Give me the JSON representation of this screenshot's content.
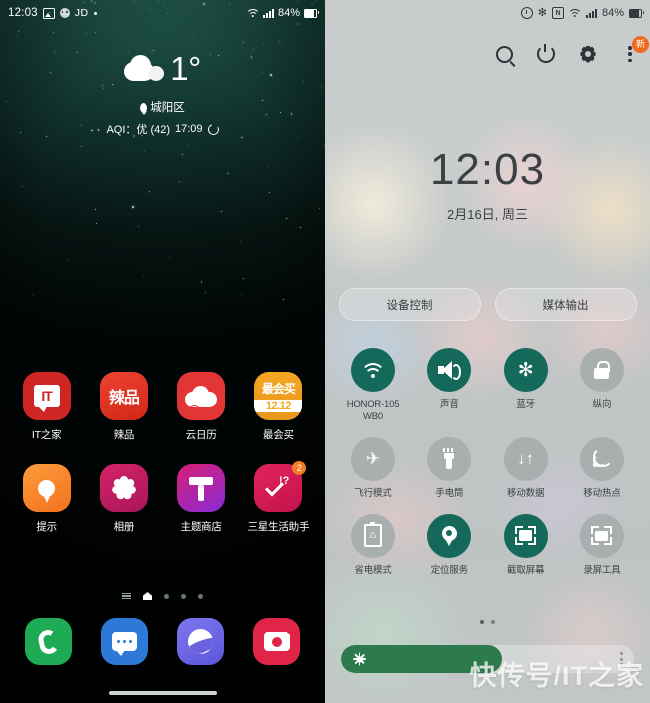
{
  "home": {
    "statusbar": {
      "time": "12:03",
      "icons": [
        "gallery-icon",
        "face-icon"
      ],
      "app_tag": "JD",
      "dot": "•",
      "wifi": "wifi-icon",
      "signal": "signal-bars-icon",
      "battery_pct": "84%",
      "battery": "battery-icon"
    },
    "weather": {
      "condition_icon": "cloud-icon",
      "temperature": "1°",
      "location": "城阳区",
      "location_icon": "location-pin-icon",
      "aqi": "AQI：优 (42)",
      "updated": "17:09",
      "refresh_icon": "refresh-icon"
    },
    "apps": [
      [
        {
          "label": "IT之家",
          "icon": "it-home-icon",
          "glyph": "IT"
        },
        {
          "label": "辣品",
          "icon": "lapin-icon",
          "glyph": "辣品"
        },
        {
          "label": "云日历",
          "icon": "cloud-calendar-icon",
          "glyph": ""
        },
        {
          "label": "最会买",
          "icon": "zuihuimai-icon",
          "glyph": "最会买",
          "sub": "12.12"
        }
      ],
      [
        {
          "label": "提示",
          "icon": "tips-icon",
          "glyph": ""
        },
        {
          "label": "相册",
          "icon": "gallery-app-icon",
          "glyph": ""
        },
        {
          "label": "主题商店",
          "icon": "theme-store-icon",
          "glyph": ""
        },
        {
          "label": "三星生活助手",
          "icon": "samsung-life-assistant-icon",
          "glyph": "",
          "badge": "2"
        }
      ]
    ],
    "page_indicator": {
      "pages": 4,
      "active": 0,
      "list_icon": "app-list-icon",
      "home_icon": "home-page-icon"
    },
    "dock": [
      {
        "label": "phone",
        "icon": "phone-icon"
      },
      {
        "label": "messages",
        "icon": "messages-icon"
      },
      {
        "label": "internet",
        "icon": "internet-browser-icon"
      },
      {
        "label": "camera",
        "icon": "camera-icon"
      }
    ],
    "nav_handle": "navigation-handle"
  },
  "panel": {
    "statusbar": {
      "alarm": "alarm-icon",
      "bluetooth": "bluetooth-icon",
      "bt_glyph": "✻",
      "nfc": "nfc-icon",
      "nfc_glyph": "N",
      "wifi": "wifi-icon",
      "signal": "signal-bars-icon",
      "battery_pct": "84%",
      "battery": "battery-icon"
    },
    "header": {
      "search": "search-icon",
      "power": "power-icon",
      "settings": "gear-icon",
      "more": "more-options-icon",
      "more_badge": "新"
    },
    "clock": {
      "time": "12:03",
      "date": "2月16日, 周三"
    },
    "pills": [
      {
        "label": "设备控制"
      },
      {
        "label": "媒体输出"
      }
    ],
    "tiles": [
      [
        {
          "label": "HONOR-105\nWB0",
          "label_line1": "HONOR-105",
          "label_line2": "WB0",
          "icon": "wifi-tile-icon",
          "state": "on"
        },
        {
          "label": "声音",
          "icon": "sound-tile-icon",
          "state": "on"
        },
        {
          "label": "蓝牙",
          "icon": "bluetooth-tile-icon",
          "state": "on"
        },
        {
          "label": "纵向",
          "icon": "portrait-lock-tile-icon",
          "state": "off"
        }
      ],
      [
        {
          "label": "飞行模式",
          "icon": "airplane-mode-tile-icon",
          "state": "off"
        },
        {
          "label": "手电筒",
          "icon": "flashlight-tile-icon",
          "state": "off"
        },
        {
          "label": "移动数据",
          "icon": "mobile-data-tile-icon",
          "state": "off"
        },
        {
          "label": "移动热点",
          "icon": "hotspot-tile-icon",
          "state": "off"
        }
      ],
      [
        {
          "label": "省电模式",
          "icon": "power-saving-tile-icon",
          "state": "off"
        },
        {
          "label": "定位服务",
          "icon": "location-tile-icon",
          "state": "on"
        },
        {
          "label": "截取屏幕",
          "icon": "screenshot-tile-icon",
          "state": "on"
        },
        {
          "label": "录屏工具",
          "icon": "screen-recorder-tile-icon",
          "state": "off"
        }
      ]
    ],
    "page_dots": {
      "count": 2,
      "active": 0
    },
    "brightness": {
      "value": 55,
      "icon": "brightness-sun-icon",
      "menu": "brightness-more-icon"
    },
    "watermark": "快传号/IT之家"
  },
  "colors": {
    "tile_on": "#15695a",
    "tile_off": "#a9aeae",
    "brightness_fill": "#2d7a4c",
    "badge_orange": "#f0691c"
  }
}
